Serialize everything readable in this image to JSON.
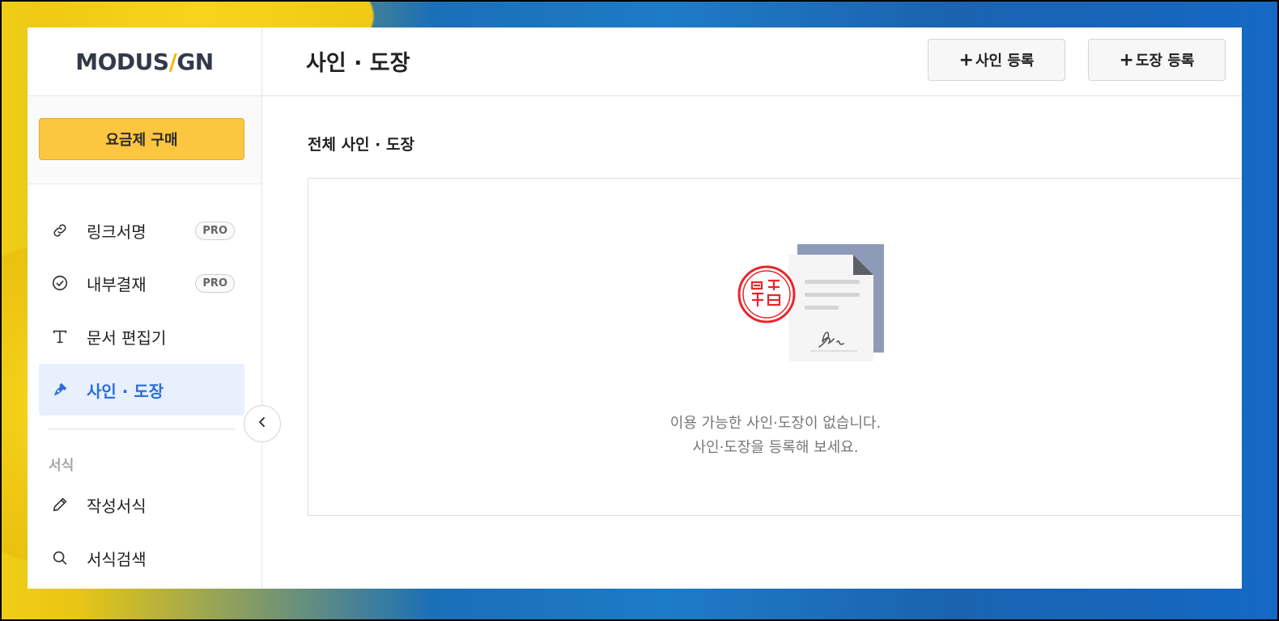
{
  "brand": {
    "logo_left": "MODUS",
    "logo_slash": "/",
    "logo_right": "GN"
  },
  "sidebar": {
    "buy_button": "요금제 구매",
    "items": [
      {
        "label": "링크서명",
        "badge": "PRO",
        "icon": "link-icon"
      },
      {
        "label": "내부결재",
        "badge": "PRO",
        "icon": "check-circle-icon"
      },
      {
        "label": "문서 편집기",
        "icon": "text-t-icon"
      },
      {
        "label": "사인 · 도장",
        "icon": "pen-nib-icon",
        "active": true
      }
    ],
    "section_label": "서식",
    "section_items": [
      {
        "label": "작성서식",
        "icon": "pencil-icon"
      },
      {
        "label": "서식검색",
        "icon": "search-icon"
      }
    ]
  },
  "header": {
    "title": "사인 · 도장",
    "add_sign_label": "사인 등록",
    "add_stamp_label": "도장 등록"
  },
  "content": {
    "section_title": "전체 사인 · 도장",
    "empty_line1": "이용 가능한 사인·도장이 없습니다.",
    "empty_line2": "사인·도장을 등록해 보세요."
  },
  "colors": {
    "accent_yellow": "#fdc640",
    "active_blue": "#2a6ed8",
    "active_bg": "#e7f0fc",
    "stamp_red": "#e8262b"
  }
}
